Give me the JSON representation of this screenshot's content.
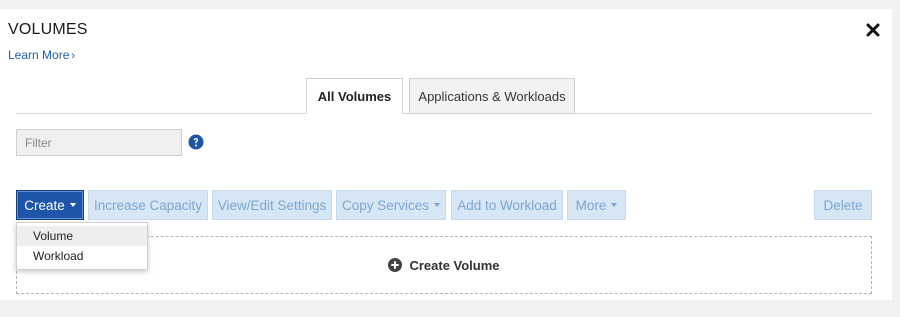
{
  "header": {
    "title": "VOLUMES",
    "learn_more": "Learn More",
    "learn_more_chevron": "›"
  },
  "tabs": [
    {
      "label": "All Volumes",
      "active": true
    },
    {
      "label": "Applications & Workloads",
      "active": false
    }
  ],
  "filter": {
    "placeholder": "Filter",
    "value": ""
  },
  "toolbar": {
    "create": "Create",
    "increase_capacity": "Increase Capacity",
    "view_edit_settings": "View/Edit Settings",
    "copy_services": "Copy Services",
    "add_to_workload": "Add to Workload",
    "more": "More",
    "delete": "Delete"
  },
  "create_menu": {
    "items": [
      "Volume",
      "Workload"
    ]
  },
  "empty_state": {
    "label": "Create Volume"
  },
  "icons": {
    "close": "close-icon",
    "help": "question-circle-icon",
    "plus": "plus-circle-icon"
  },
  "colors": {
    "primary_button": "#1f55a8",
    "disabled_button_bg": "#d6e6f5",
    "disabled_button_text": "#7da6cf",
    "link": "#1d5fa8"
  }
}
